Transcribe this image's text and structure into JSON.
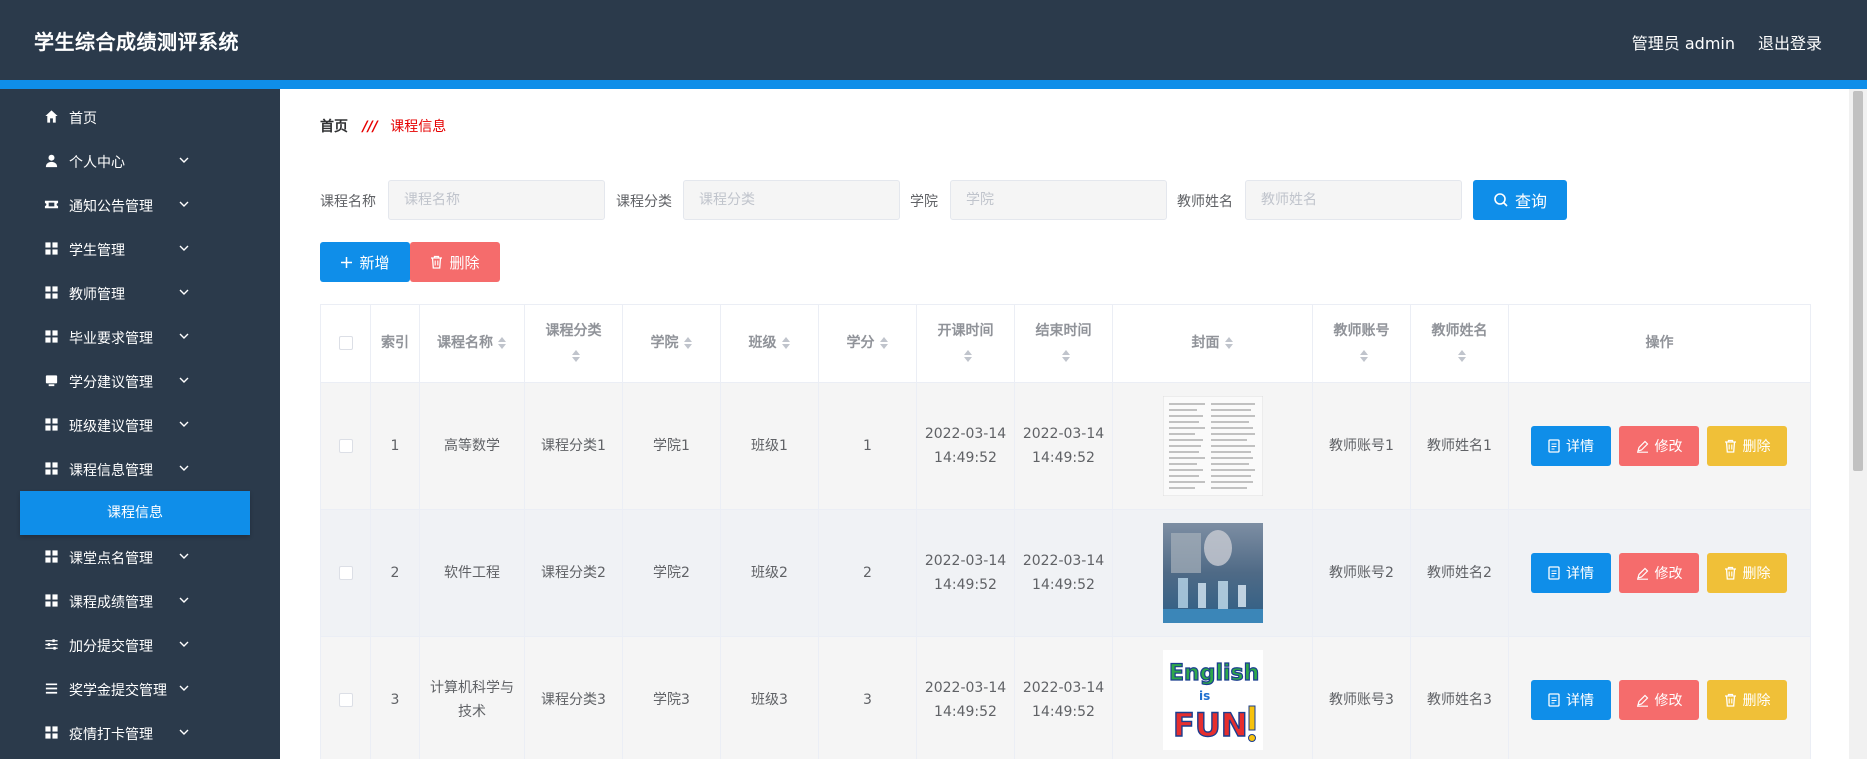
{
  "header": {
    "app_title": "学生综合成绩测评系统",
    "user_label": "管理员 admin",
    "logout_label": "退出登录"
  },
  "sidebar": {
    "items": [
      {
        "label": "首页",
        "icon": "home-icon",
        "expandable": false
      },
      {
        "label": "个人中心",
        "icon": "user-icon",
        "expandable": true
      },
      {
        "label": "通知公告管理",
        "icon": "ticket-icon",
        "expandable": true
      },
      {
        "label": "学生管理",
        "icon": "grid-icon",
        "expandable": true
      },
      {
        "label": "教师管理",
        "icon": "grid-icon",
        "expandable": true
      },
      {
        "label": "毕业要求管理",
        "icon": "grid-icon",
        "expandable": true
      },
      {
        "label": "学分建议管理",
        "icon": "tablet-icon",
        "expandable": true
      },
      {
        "label": "班级建议管理",
        "icon": "grid-icon",
        "expandable": true
      },
      {
        "label": "课程信息管理",
        "icon": "grid-icon",
        "expandable": true
      },
      {
        "label": "课堂点名管理",
        "icon": "grid-icon",
        "expandable": true
      },
      {
        "label": "课程成绩管理",
        "icon": "grid-icon",
        "expandable": true
      },
      {
        "label": "加分提交管理",
        "icon": "sliders-icon",
        "expandable": true
      },
      {
        "label": "奖学金提交管理",
        "icon": "list-icon",
        "expandable": true
      },
      {
        "label": "疫情打卡管理",
        "icon": "grid-icon",
        "expandable": true
      }
    ],
    "active_sub_item": "课程信息"
  },
  "breadcrumb": {
    "home": "首页",
    "current": "课程信息"
  },
  "search": {
    "fields": [
      {
        "label": "课程名称",
        "placeholder": "课程名称",
        "value": ""
      },
      {
        "label": "课程分类",
        "placeholder": "课程分类",
        "value": ""
      },
      {
        "label": "学院",
        "placeholder": "学院",
        "value": ""
      },
      {
        "label": "教师姓名",
        "placeholder": "教师姓名",
        "value": ""
      }
    ],
    "query_label": "查询"
  },
  "toolbar": {
    "add_label": "新增",
    "delete_label": "删除"
  },
  "table": {
    "columns": [
      "索引",
      "课程名称",
      "课程分类",
      "学院",
      "班级",
      "学分",
      "开课时间",
      "结束时间",
      "封面",
      "教师账号",
      "教师姓名",
      "操作"
    ],
    "rows": [
      {
        "index": "1",
        "course_name": "高等数学",
        "category": "课程分类1",
        "college": "学院1",
        "class": "班级1",
        "credit": "1",
        "start": "2022-03-14 14:49:52",
        "end": "2022-03-14 14:49:52",
        "cover": "document-thumbnail",
        "teacher_account": "教师账号1",
        "teacher_name": "教师姓名1"
      },
      {
        "index": "2",
        "course_name": "软件工程",
        "category": "课程分类2",
        "college": "学院2",
        "class": "班级2",
        "credit": "2",
        "start": "2022-03-14 14:49:52",
        "end": "2022-03-14 14:49:52",
        "cover": "lab-photo-thumbnail",
        "teacher_account": "教师账号2",
        "teacher_name": "教师姓名2"
      },
      {
        "index": "3",
        "course_name": "计算机科学与技术",
        "category": "课程分类3",
        "college": "学院3",
        "class": "班级3",
        "credit": "3",
        "start": "2022-03-14 14:49:52",
        "end": "2022-03-14 14:49:52",
        "cover": "english-is-fun-thumbnail",
        "teacher_account": "教师账号3",
        "teacher_name": "教师姓名3"
      }
    ],
    "row_actions": {
      "detail_label": "详情",
      "edit_label": "修改",
      "delete_label": "删除"
    }
  },
  "colors": {
    "header_bg": "#2b3a4b",
    "accent": "#0f8ee9",
    "danger": "#f56c6c",
    "warning": "#f0c038",
    "breadcrumb_current": "#e60000"
  }
}
